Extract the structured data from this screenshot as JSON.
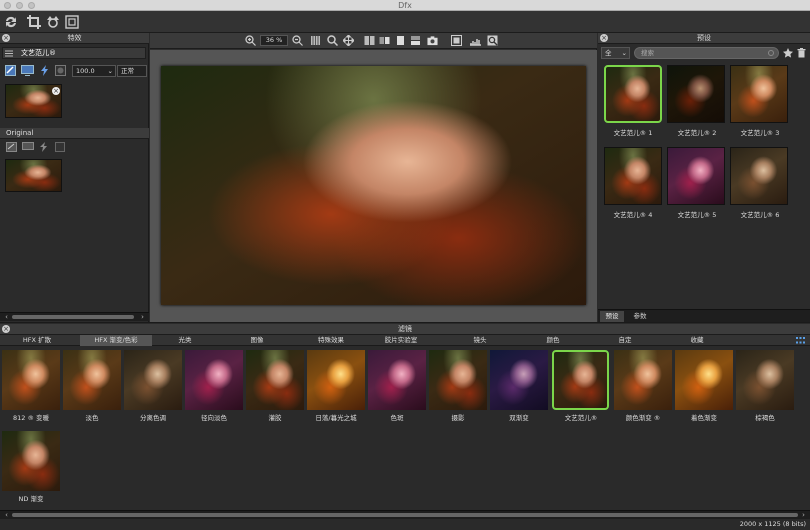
{
  "window": {
    "title": "Dfx"
  },
  "left_panel": {
    "title": "特效",
    "effect_name": "文艺范儿®",
    "opacity_value": "100.0",
    "blend_mode": "正常",
    "original_label": "Original"
  },
  "center": {
    "zoom": "36 %"
  },
  "right_panel": {
    "title": "预设",
    "filter_select": "全",
    "search_placeholder": "搜索",
    "presets": [
      "文艺范儿® 1",
      "文艺范儿® 2",
      "文艺范儿® 3",
      "文艺范儿® 4",
      "文艺范儿® 5",
      "文艺范儿® 6"
    ],
    "tabs": [
      "预设",
      "参数"
    ]
  },
  "bottom_panel": {
    "title": "滤镜",
    "categories": [
      "HFX 扩散",
      "HFX 渐变/色彩",
      "光类",
      "图像",
      "特殊效果",
      "胶片实验室",
      "镜头",
      "颜色",
      "自定",
      "收藏"
    ],
    "filters": [
      "812 ® 变暖",
      "淡色",
      "分离色调",
      "径向淡色",
      "灌胶",
      "日落/暮光之城",
      "色斑",
      "摄影",
      "双渐变",
      "文艺范儿®",
      "颜色渐变 ®",
      "着色渐变",
      "棕褐色",
      "ND 渐变"
    ],
    "status": "2000 x 1125 (8 bits)"
  },
  "colors": {
    "selection": "#7bd64a",
    "panel": "#2b2b2b",
    "header": "#3c3c3c"
  }
}
